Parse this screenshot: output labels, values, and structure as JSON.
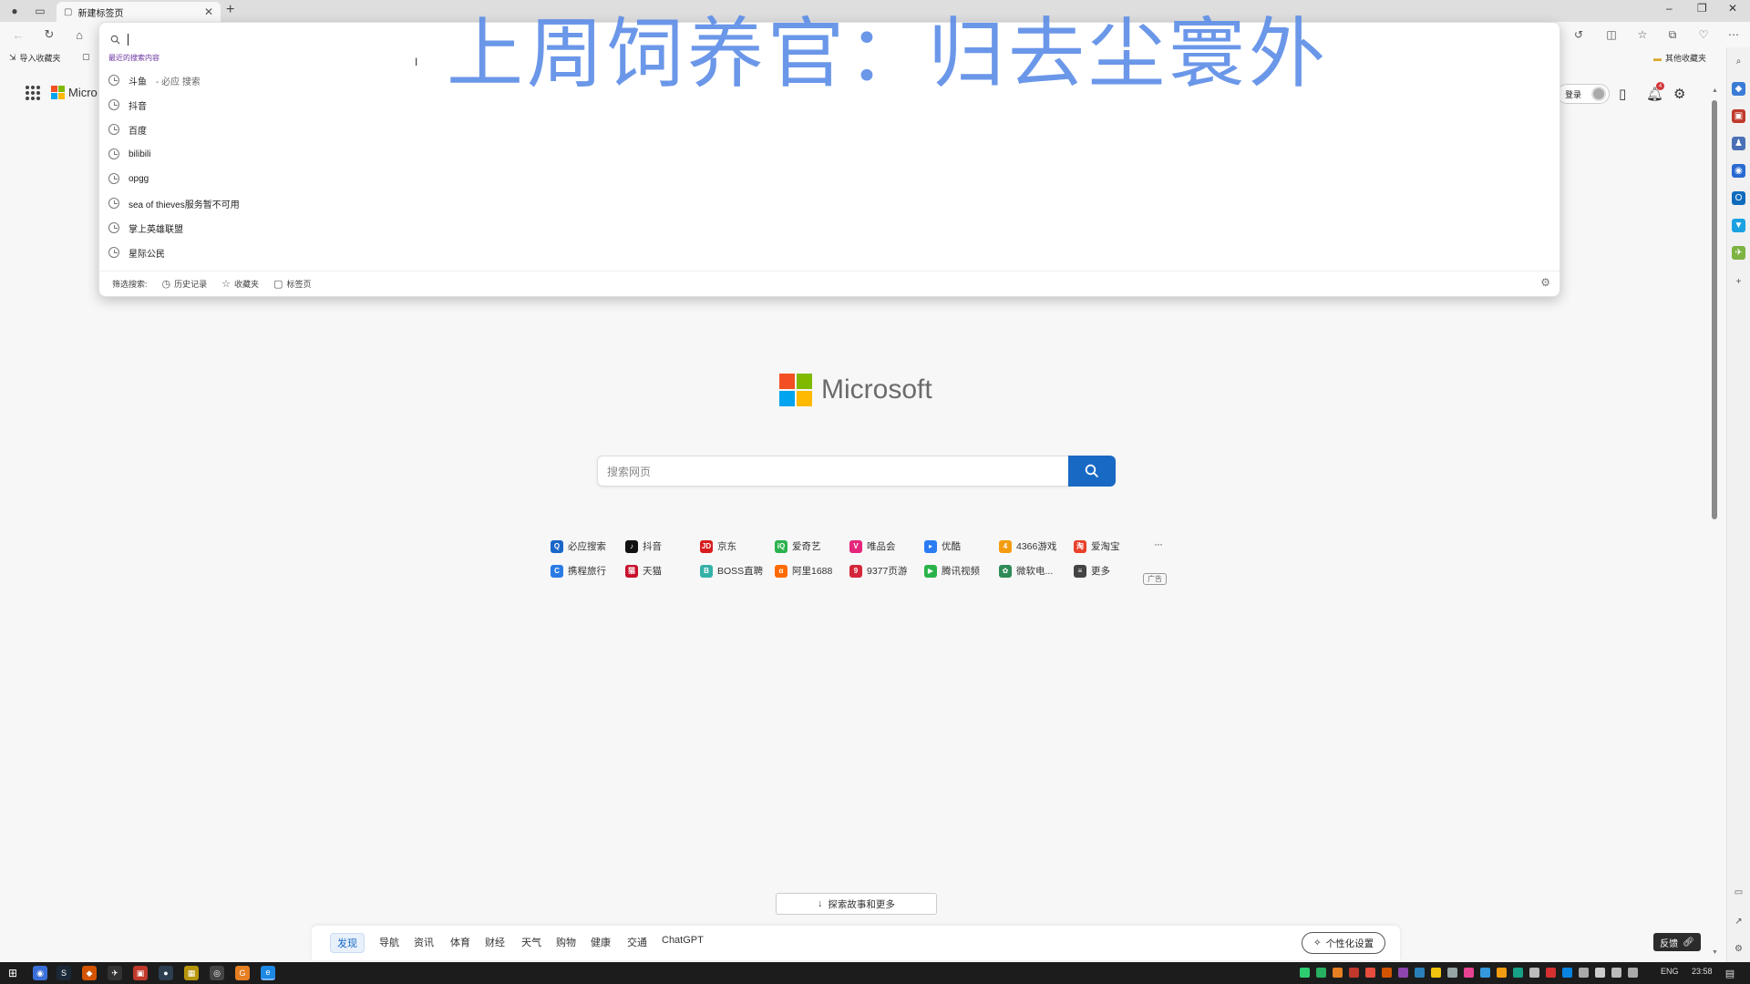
{
  "tab": {
    "title": "新建标签页"
  },
  "favbar": {
    "import_label": "导入收藏夹",
    "other_favorites": "其他收藏夹"
  },
  "ntp": {
    "brand_small": "Micro",
    "brand_big": "Microsoft",
    "login_label": "登录",
    "notification_count": "4",
    "search_placeholder": "搜索网页",
    "quicklinks": [
      {
        "label": "必应搜索",
        "color": "#1a66c9",
        "glyph": "Q"
      },
      {
        "label": "抖音",
        "color": "#111111",
        "glyph": "♪"
      },
      {
        "label": "京东",
        "color": "#d71c1e",
        "glyph": "JD"
      },
      {
        "label": "爱奇艺",
        "color": "#2bb24c",
        "glyph": "iQ"
      },
      {
        "label": "唯品会",
        "color": "#e5267d",
        "glyph": "V"
      },
      {
        "label": "优酷",
        "color": "#2a7bf4",
        "glyph": "▸"
      },
      {
        "label": "4366游戏",
        "color": "#f39c12",
        "glyph": "4"
      },
      {
        "label": "爱淘宝",
        "color": "#e8402a",
        "glyph": "淘"
      },
      {
        "label": "携程旅行",
        "color": "#2b7be5",
        "glyph": "C"
      },
      {
        "label": "天猫",
        "color": "#c8102e",
        "glyph": "猫"
      },
      {
        "label": "BOSS直聘",
        "color": "#35b1a8",
        "glyph": "B"
      },
      {
        "label": "阿里1688",
        "color": "#ff6a00",
        "glyph": "α"
      },
      {
        "label": "9377页游",
        "color": "#d4273a",
        "glyph": "9"
      },
      {
        "label": "腾讯视频",
        "color": "#2ab34a",
        "glyph": "▶"
      },
      {
        "label": "微软电...",
        "color": "#2e8b57",
        "glyph": "✿"
      },
      {
        "label": "更多",
        "color": "#444444",
        "glyph": "≡"
      }
    ],
    "ad_label": "广告",
    "more_dots": "···",
    "explore_label": "探索故事和更多",
    "feed_tabs": [
      "发现",
      "导航",
      "资讯",
      "体育",
      "财经",
      "天气",
      "购物",
      "健康",
      "交通",
      "ChatGPT"
    ],
    "personalize_label": "个性化设置",
    "feedback_label": "反馈"
  },
  "dropdown": {
    "recent_header": "最近的搜索内容",
    "suggestions": [
      {
        "text": "斗鱼",
        "suffix": " - 必应 搜索"
      },
      {
        "text": "抖音",
        "suffix": ""
      },
      {
        "text": "百度",
        "suffix": ""
      },
      {
        "text": "bilibili",
        "suffix": ""
      },
      {
        "text": "opgg",
        "suffix": ""
      },
      {
        "text": "sea of thieves服务暂不可用",
        "suffix": ""
      },
      {
        "text": "掌上英雄联盟",
        "suffix": ""
      },
      {
        "text": "星际公民",
        "suffix": ""
      }
    ],
    "filter_label": "筛选搜索:",
    "filters": [
      "历史记录",
      "收藏夹",
      "标签页"
    ]
  },
  "watermark": "上周饲养官：归去尘寰外",
  "taskbar": {
    "lang": "ENG",
    "time": "23:58"
  },
  "colors": {
    "accent": "#1869c4",
    "watermark": "#5f8fe8"
  }
}
